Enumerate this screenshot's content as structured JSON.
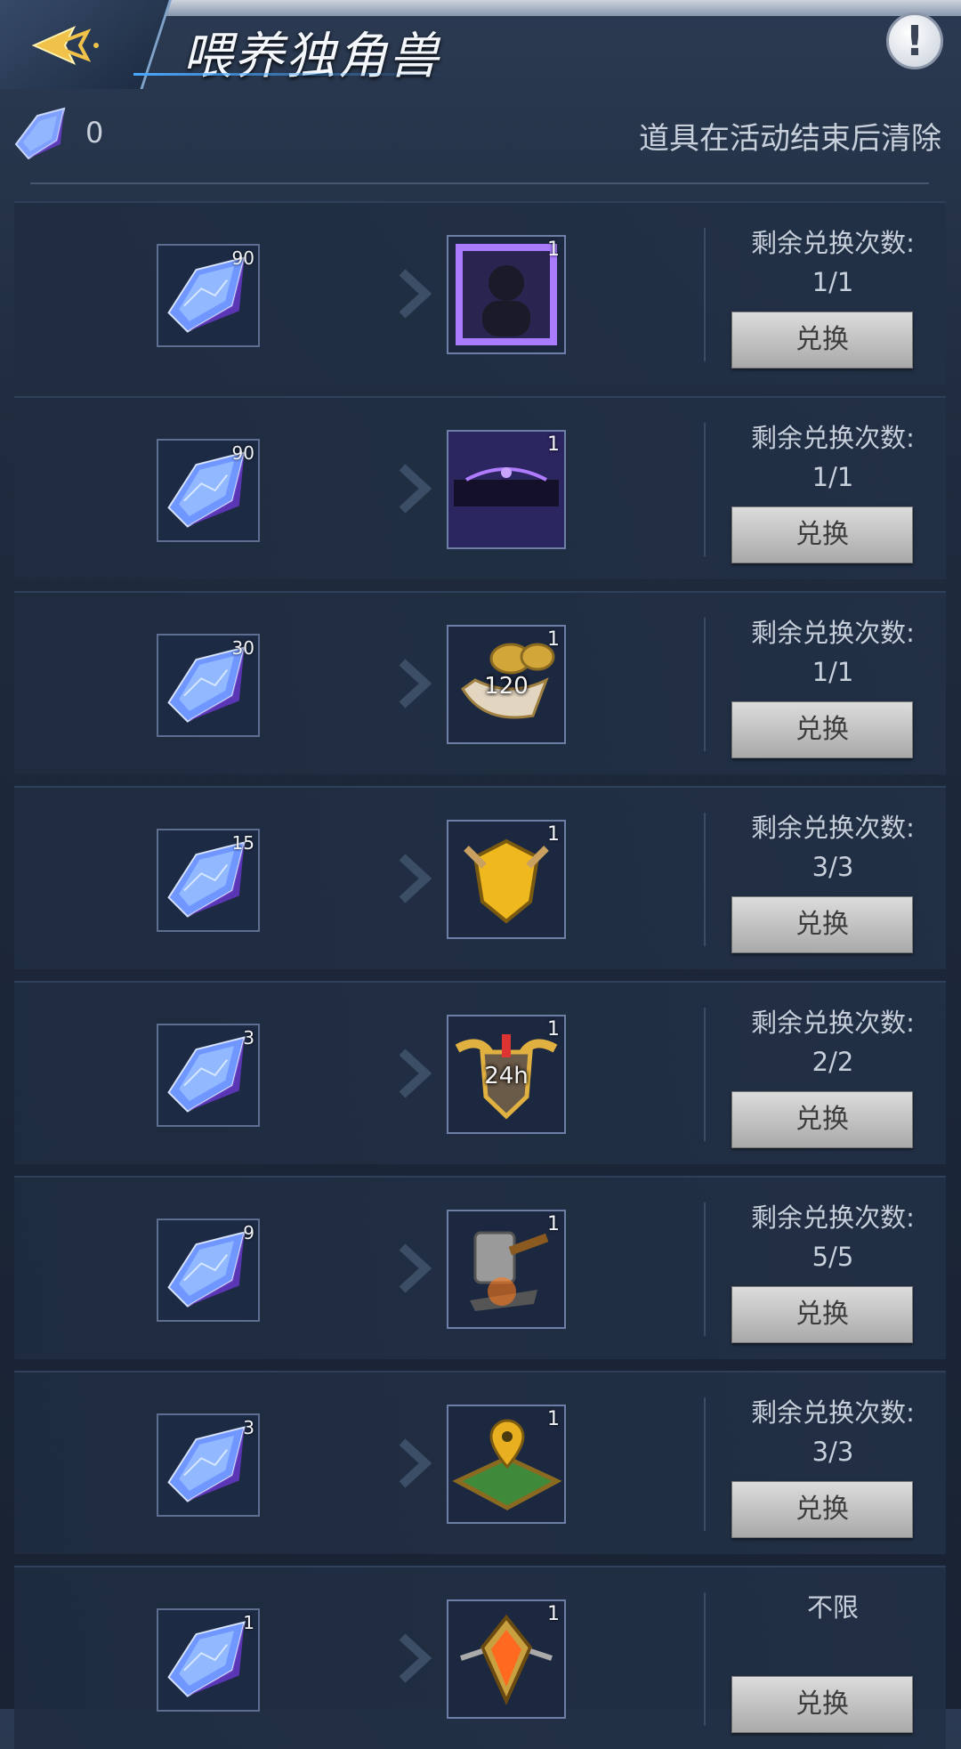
{
  "header": {
    "title": "喂养独角兽",
    "back_icon": "back-arrow-icon",
    "info_icon": "exclamation-icon",
    "info_glyph": "!"
  },
  "balance": {
    "count": "0",
    "notice": "道具在活动结束后清除",
    "icon": "crystal-gem-icon"
  },
  "labels": {
    "remaining": "剩余兑换次数:",
    "exchange": "兑换"
  },
  "rows": [
    {
      "cost": "90",
      "reward_count": "1",
      "reward_icon": "avatar-frame-icon",
      "overlay": "",
      "remaining": "1/1",
      "button": "兑换"
    },
    {
      "cost": "90",
      "reward_count": "1",
      "reward_icon": "name-banner-icon",
      "overlay": "",
      "remaining": "1/1",
      "button": "兑换"
    },
    {
      "cost": "30",
      "reward_count": "1",
      "reward_icon": "golden-horn-icon",
      "overlay": "120",
      "remaining": "1/1",
      "button": "兑换"
    },
    {
      "cost": "15",
      "reward_count": "1",
      "reward_icon": "golden-shield-icon",
      "overlay": "",
      "remaining": "3/3",
      "button": "兑换"
    },
    {
      "cost": "3",
      "reward_count": "1",
      "reward_icon": "winged-shield-icon",
      "overlay": "24h",
      "remaining": "2/2",
      "button": "兑换"
    },
    {
      "cost": "9",
      "reward_count": "1",
      "reward_icon": "forge-hammer-icon",
      "overlay": "",
      "remaining": "5/5",
      "button": "兑换"
    },
    {
      "cost": "3",
      "reward_count": "1",
      "reward_icon": "map-pin-icon",
      "overlay": "",
      "remaining": "3/3",
      "button": "兑换"
    },
    {
      "cost": "1",
      "reward_count": "1",
      "reward_icon": "orange-gem-badge-icon",
      "overlay": "",
      "remaining": "不限",
      "button": "兑换"
    }
  ]
}
